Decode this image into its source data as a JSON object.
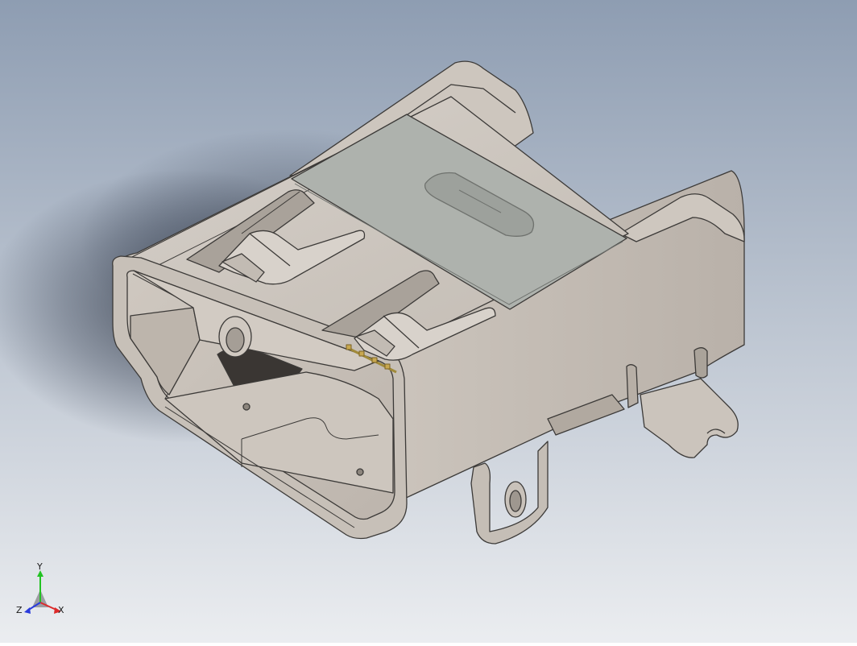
{
  "viewport": {
    "background_top": "#8e9db2",
    "background_bottom": "#ebedf0"
  },
  "part": {
    "body_color": "#c8c1ba",
    "edge_color": "#3c3a38",
    "label_plate_color": "#aeb2ad"
  },
  "triad": {
    "y_label": "Y",
    "z_label": "Z",
    "x_label": "X",
    "colors": {
      "y": "#22c222",
      "z": "#2a3cdc",
      "x": "#dc2a2a"
    }
  }
}
